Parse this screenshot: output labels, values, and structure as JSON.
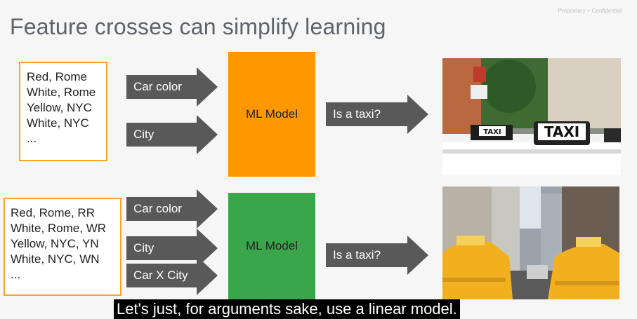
{
  "title": "Feature crosses can simplify learning",
  "confidential": "Proprietary + Confidential",
  "top": {
    "inputs": [
      "Red, Rome",
      "White, Rome",
      "Yellow, NYC",
      "White, NYC",
      "..."
    ],
    "features": [
      "Car color",
      "City"
    ],
    "model_label": "ML Model",
    "output_label": "Is a taxi?",
    "model_color": "#ff9800"
  },
  "bottom": {
    "inputs": [
      "Red, Rome, RR",
      "White, Rome, WR",
      "Yellow, NYC, YN",
      "White, NYC, WN",
      "..."
    ],
    "features": [
      "Car color",
      "City",
      "Car X City"
    ],
    "model_label": "ML Model",
    "output_label": "Is a taxi?",
    "model_color": "#3aa64c"
  },
  "caption": "Let's just, for arguments sake, use a linear model."
}
